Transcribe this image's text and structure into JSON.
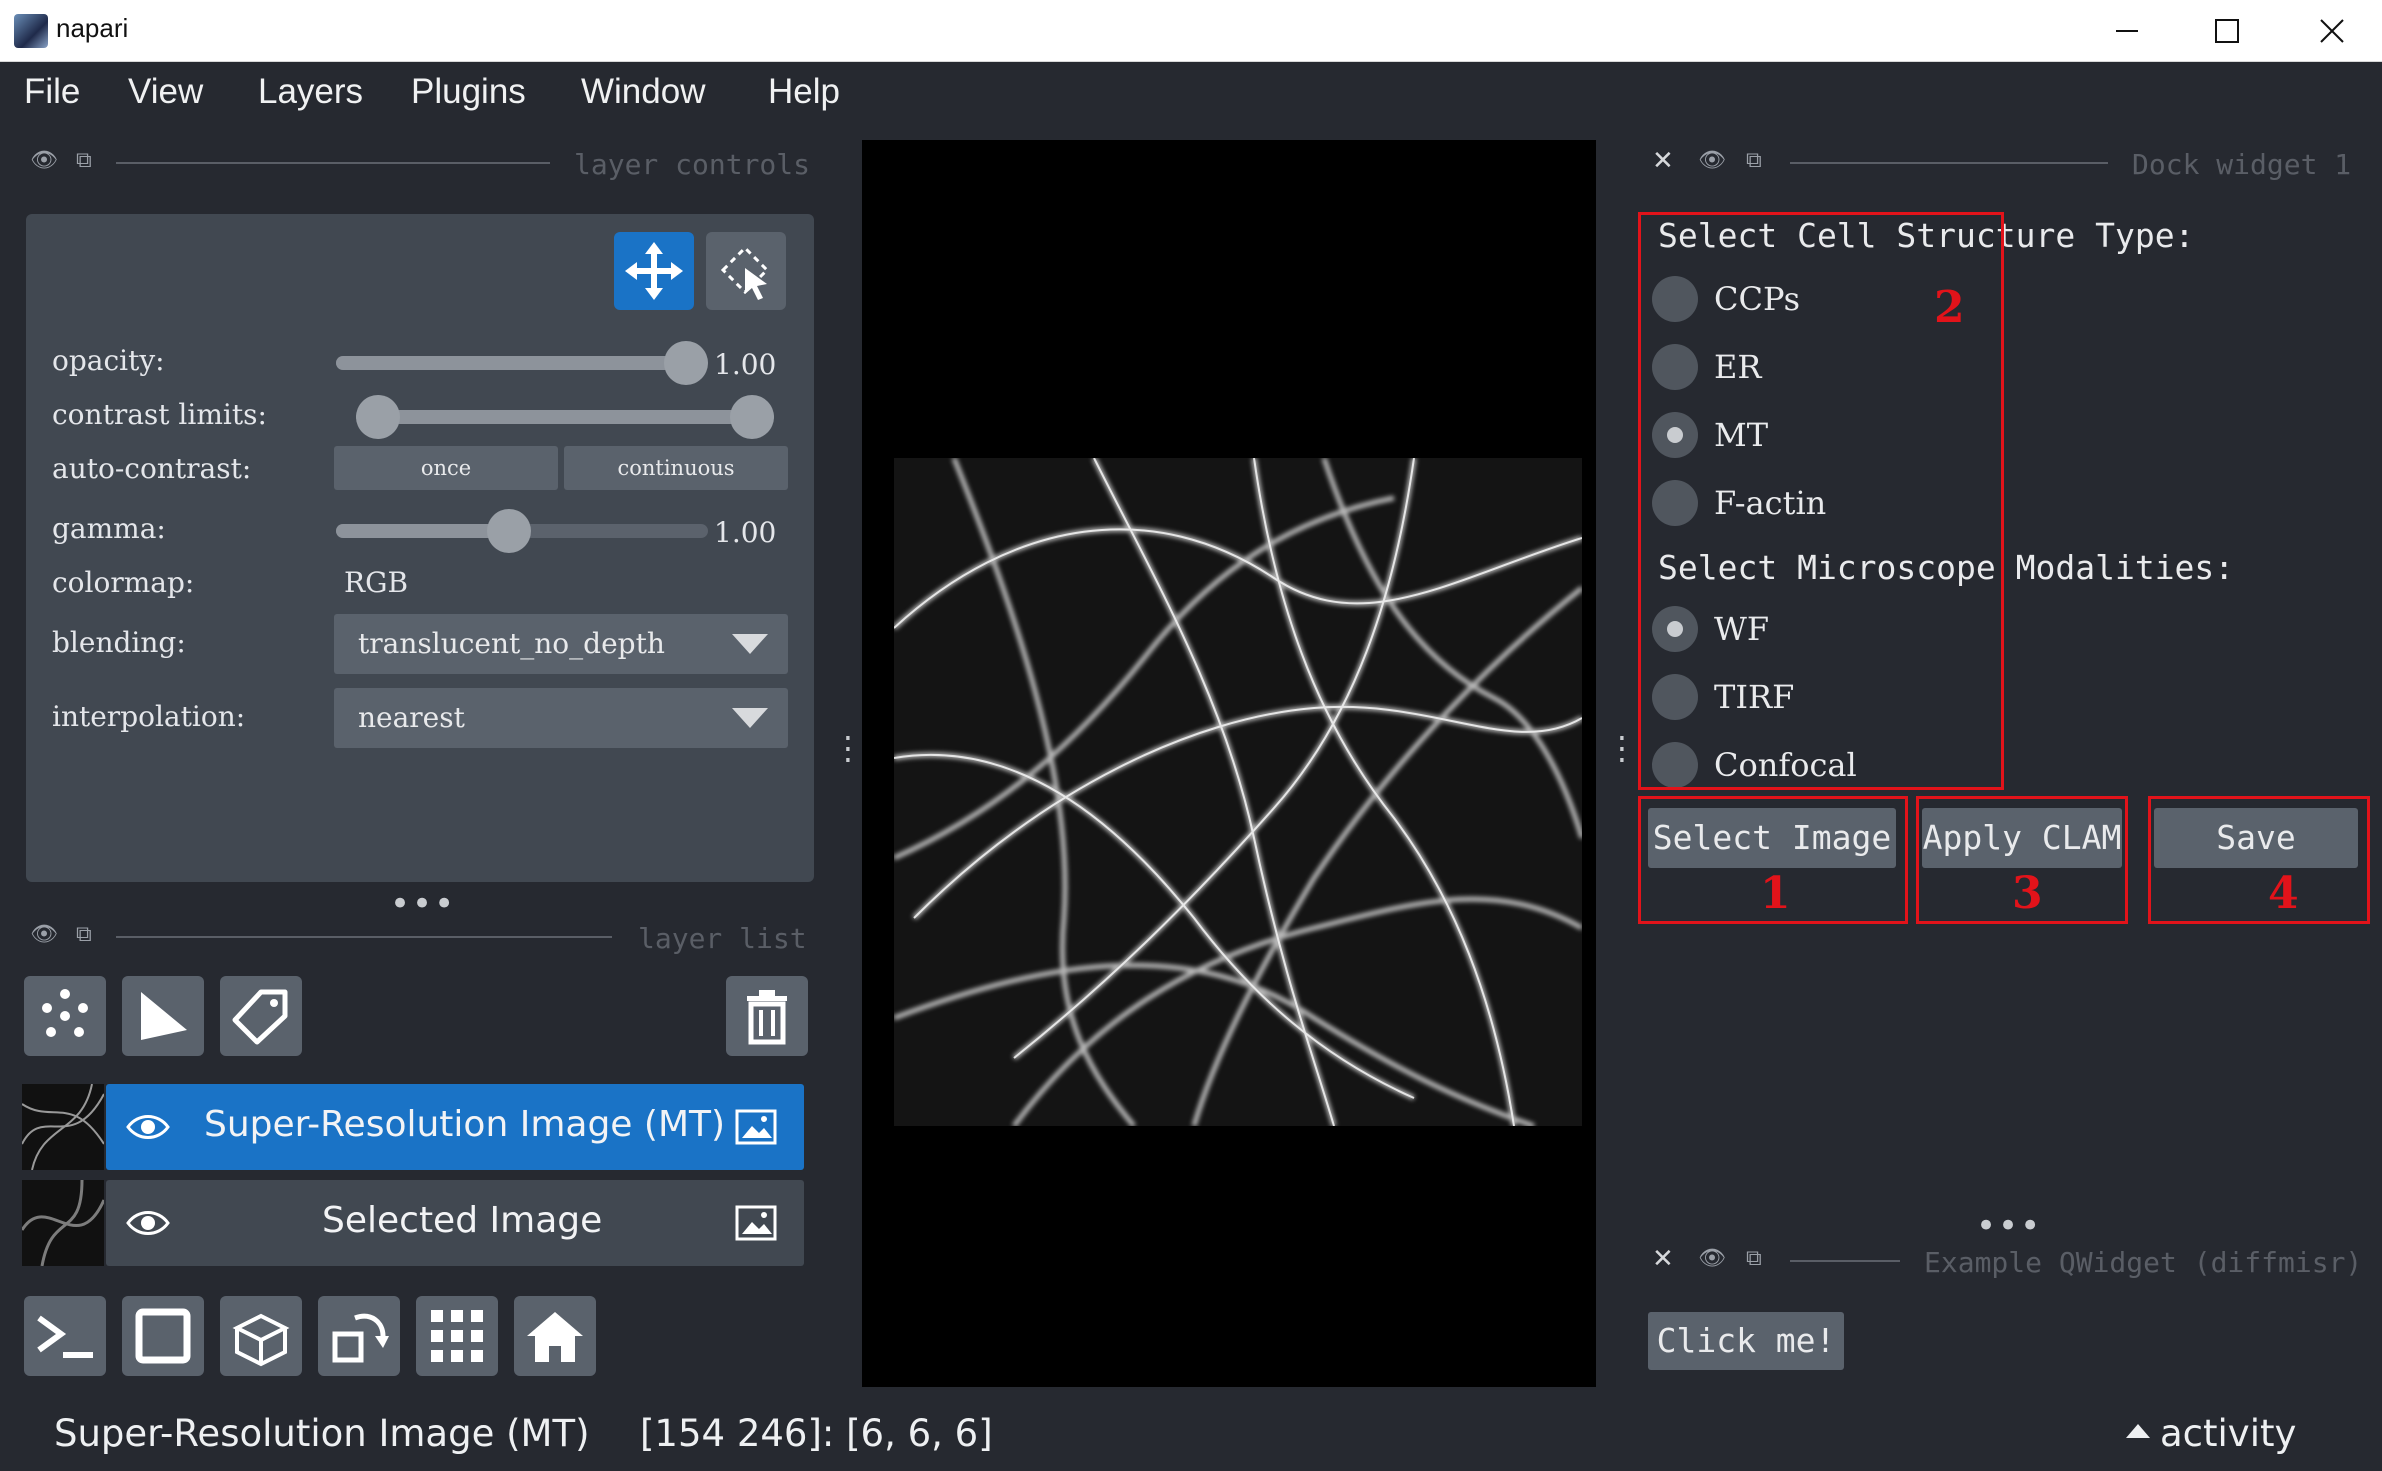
{
  "window": {
    "title": "napari"
  },
  "menu": [
    "File",
    "View",
    "Layers",
    "Plugins",
    "Window",
    "Help"
  ],
  "layer_controls": {
    "header": "layer controls",
    "opacity": {
      "label": "opacity:",
      "value": "1.00",
      "level": 1.0
    },
    "contrast_limits": {
      "label": "contrast limits:",
      "low": 0.0,
      "high": 1.0
    },
    "auto_contrast": {
      "label": "auto-contrast:",
      "once": "once",
      "continuous": "continuous"
    },
    "gamma": {
      "label": "gamma:",
      "value": "1.00",
      "level": 0.46
    },
    "colormap": {
      "label": "colormap:",
      "value": "RGB"
    },
    "blending": {
      "label": "blending:",
      "value": "translucent_no_depth"
    },
    "interpolation": {
      "label": "interpolation:",
      "value": "nearest"
    }
  },
  "layer_list": {
    "header": "layer list",
    "layers": [
      {
        "name": "Super-Resolution Image (MT)",
        "selected": true
      },
      {
        "name": "Selected Image",
        "selected": false
      }
    ]
  },
  "dock_widget": {
    "title": "Dock widget 1",
    "structure_title": "Select Cell Structure Type:",
    "structures": [
      "CCPs",
      "ER",
      "MT",
      "F-actin"
    ],
    "structure_selected": "MT",
    "modality_title": "Select Microscope Modalities:",
    "modalities": [
      "WF",
      "TIRF",
      "Confocal"
    ],
    "modality_selected": "WF",
    "buttons": [
      "Select Image",
      "Apply CLAM",
      "Save"
    ],
    "annotations": [
      "1",
      "2",
      "3",
      "4"
    ]
  },
  "example_widget": {
    "title": "Example QWidget (diffmisr)",
    "button": "Click me!"
  },
  "status": {
    "layer": "Super-Resolution Image (MT)",
    "coords": "[154 246]: [6, 6, 6]",
    "activity": "activity"
  },
  "colors": {
    "bg": "#262930",
    "panel": "#414851",
    "accent": "#1a73c6",
    "annotation": "#e2131a"
  }
}
